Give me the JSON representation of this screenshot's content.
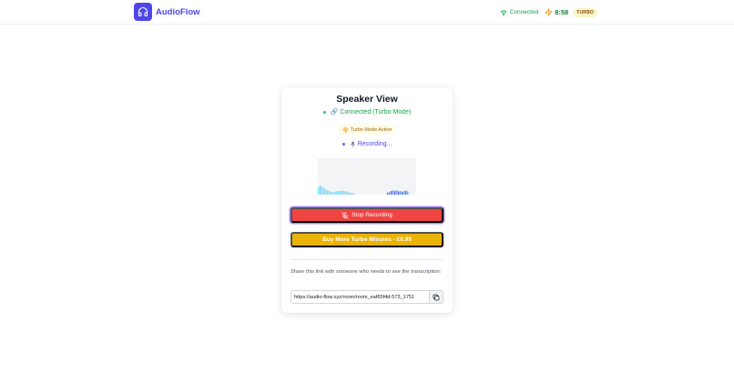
{
  "brand": {
    "name": "AudioFlow",
    "color": "#4f46e5"
  },
  "nav": {
    "connection_status": "Connected",
    "timer": "8:58",
    "badge": "TURBO",
    "icons": [
      "wifi-icon",
      "lightning-bolt-icon"
    ]
  },
  "card": {
    "title": "Speaker View",
    "status_connected": "🔗 Connected (Turbo Mode)",
    "turbo_status": "Turbo Mode Active",
    "status_recording": "Recording...",
    "stop_button": "Stop Recording",
    "buy_button": "Buy More Turbo Minutes - £0.99",
    "share_text": "Share this link with someone who needs to see the transcription:",
    "share_link": "https://audio-flow.xyz/room/room_eaf65f4d-573_1751"
  },
  "visualizer": {
    "levels_left": [
      0.2,
      0.25,
      0.22,
      0.18,
      0.15,
      0.12,
      0.1,
      0.08,
      0.06,
      0.08,
      0.1,
      0.09,
      0.1,
      0.11,
      0.1,
      0.09,
      0.08,
      0.06,
      0.05,
      0.04
    ],
    "levels_right": [
      0.06,
      0.08,
      0.1,
      0.12,
      0.1,
      0.12,
      0.09,
      0.1,
      0.08,
      0.1,
      0.11,
      0.09
    ]
  },
  "colors": {
    "connected": "#16a34a",
    "recording": "#4f46e5",
    "stop_button": "#ef4444",
    "buy_button": "#eab308",
    "turbo_badge_bg": "#fef3c7"
  }
}
